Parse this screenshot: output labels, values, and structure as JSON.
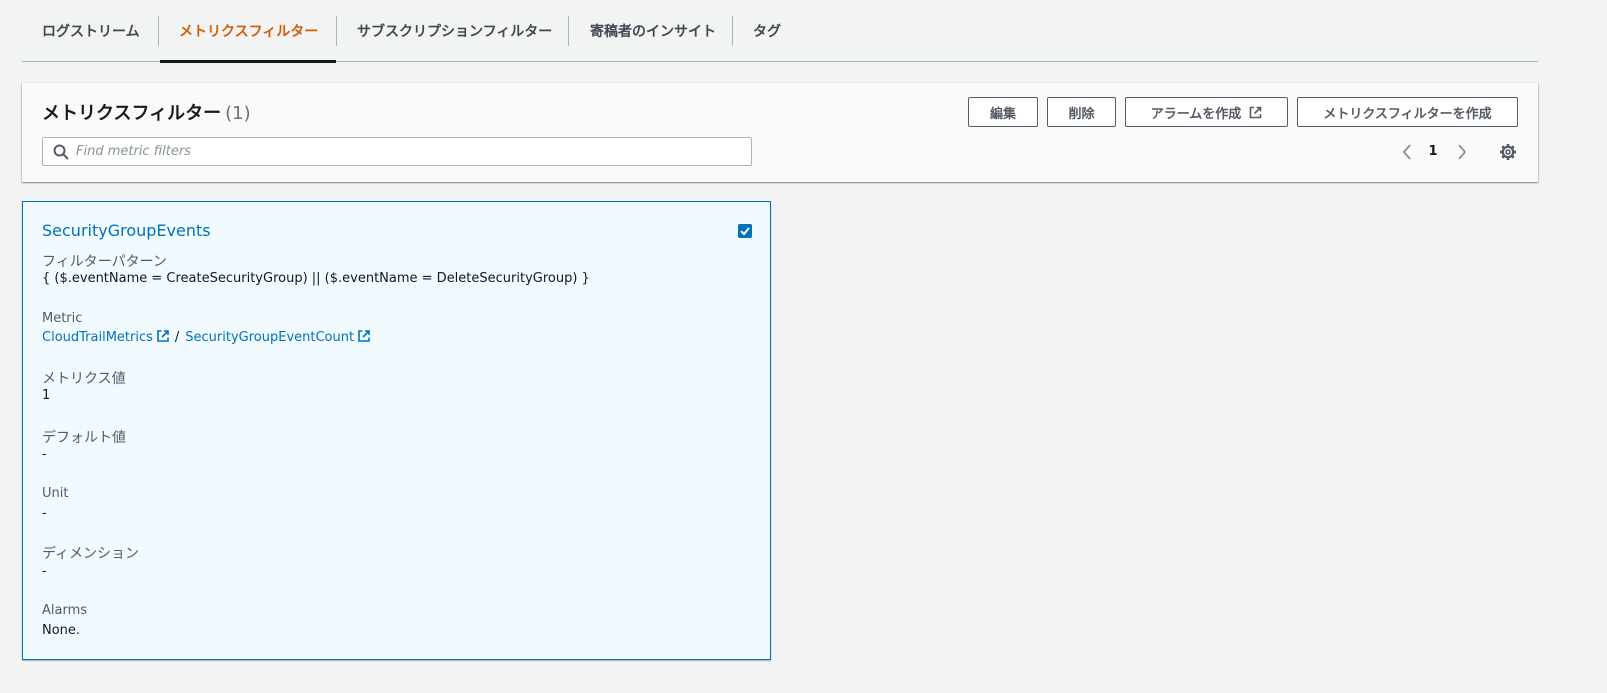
{
  "tabs": [
    {
      "label": "ログストリーム",
      "active": false
    },
    {
      "label": "メトリクスフィルター",
      "active": true
    },
    {
      "label": "サブスクリプションフィルター",
      "active": false
    },
    {
      "label": "寄稿者のインサイト",
      "active": false
    },
    {
      "label": "タグ",
      "active": false
    }
  ],
  "header": {
    "title": "メトリクスフィルター",
    "count": "(1)",
    "buttons": {
      "edit": "編集",
      "delete": "削除",
      "create_alarm": "アラームを作成",
      "create_filter": "メトリクスフィルターを作成"
    },
    "search": {
      "placeholder": "Find metric filters",
      "value": ""
    },
    "pagination": {
      "current_page": "1"
    }
  },
  "card": {
    "title": "SecurityGroupEvents",
    "selected": true,
    "fields": {
      "filter_pattern": {
        "label": "フィルターパターン",
        "value": "{ ($.eventName = CreateSecurityGroup) || ($.eventName = DeleteSecurityGroup) }"
      },
      "metric": {
        "label": "Metric",
        "namespace": "CloudTrailMetrics",
        "separator": "/",
        "name": "SecurityGroupEventCount"
      },
      "metric_value": {
        "label": "メトリクス値",
        "value": "1"
      },
      "default_value": {
        "label": "デフォルト値",
        "value": "-"
      },
      "unit": {
        "label": "Unit",
        "value": "-"
      },
      "dimensions": {
        "label": "ディメンション",
        "value": "-"
      },
      "alarms": {
        "label": "Alarms",
        "value": "None."
      }
    }
  },
  "colors": {
    "active_tab": "#d45b07",
    "link": "#0073bb",
    "card_bg": "#f1faff",
    "page_bg": "#f2f3f3"
  },
  "icons": {
    "search": "search-icon",
    "external_link": "external-link-icon",
    "chevron_left": "chevron-left-icon",
    "chevron_right": "chevron-right-icon",
    "settings": "gear-icon",
    "checkbox": "checkbox-checked-icon"
  }
}
